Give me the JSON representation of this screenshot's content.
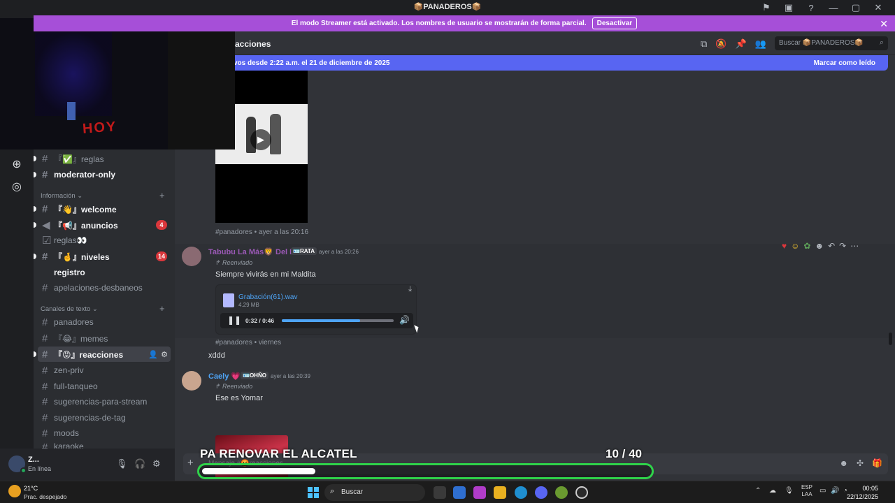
{
  "window": {
    "title": "📦PANADEROS📦"
  },
  "streamer_banner": {
    "text": "El modo Streamer está activado. Los nombres de usuario se mostrarán de forma parcial.",
    "button": "Desactivar"
  },
  "channel_header": {
    "title": "acciones",
    "search_placeholder": "Buscar 📦PANADEROS📦"
  },
  "new_messages_bar": {
    "text": "vos desde 2:22 a.m. el 21 de diciembre de 2025",
    "action": "Marcar como leído"
  },
  "sidebar": {
    "categories": {
      "informacion": "Información",
      "canales_texto": "Canales de texto"
    },
    "channels_top": [
      {
        "name": "『✅』reglas"
      },
      {
        "name": "moderator-only"
      }
    ],
    "channels_info": [
      {
        "name": "『👋』welcome"
      },
      {
        "name": "『📢』anuncios",
        "badge": "4"
      },
      {
        "name": "reglas👀"
      },
      {
        "name": "『🤞』niveles",
        "badge": "14"
      },
      {
        "name": "registro"
      },
      {
        "name": "apelaciones-desbaneos"
      }
    ],
    "channels_text": [
      {
        "name": "panadores"
      },
      {
        "name": "『😂』memes"
      },
      {
        "name": "『😡』reacciones"
      },
      {
        "name": "zen-priv"
      },
      {
        "name": "full-tanqueo"
      },
      {
        "name": "sugerencias-para-stream"
      },
      {
        "name": "sugerencias-de-tag"
      },
      {
        "name": "moods"
      },
      {
        "name": "karaoke"
      }
    ]
  },
  "user": {
    "name": "Z...",
    "status": "En línea"
  },
  "messages": {
    "video_meta": "#panadores • ayer a las 20:16",
    "msg1": {
      "author": "Tabubu La Más🦁 Del Dc",
      "tag": "🪪RATA",
      "time": "ayer a las 20:26",
      "forwarded": "Reenviado",
      "text": "Siempre vivirás en mi Maldita",
      "file_name": "Grabación(61).wav",
      "file_size": "4.29 MB",
      "player_time": "0:32 / 0:46",
      "progress": 0.7,
      "meta": "#panadores • viernes"
    },
    "msg2": {
      "text": "xddd"
    },
    "msg3": {
      "author": "Caely 💗",
      "tag": "🪪OHÑO",
      "time": "ayer a las 20:39",
      "forwarded": "Reenviado",
      "text": "Ese es Yomar"
    }
  },
  "composer": {
    "placeholder": "Mensaje #🤬reacciones"
  },
  "stream_overlay": {
    "label": "PA RENOVAR EL ALCATEL",
    "count": "10  / 40",
    "progress": 0.25
  },
  "taskbar": {
    "temp": "21°C",
    "weather": "Prac. despejado",
    "search": "Buscar",
    "lang": "ESP",
    "lang2": "LAA",
    "time": "00:05",
    "date": "22/12/2025"
  }
}
